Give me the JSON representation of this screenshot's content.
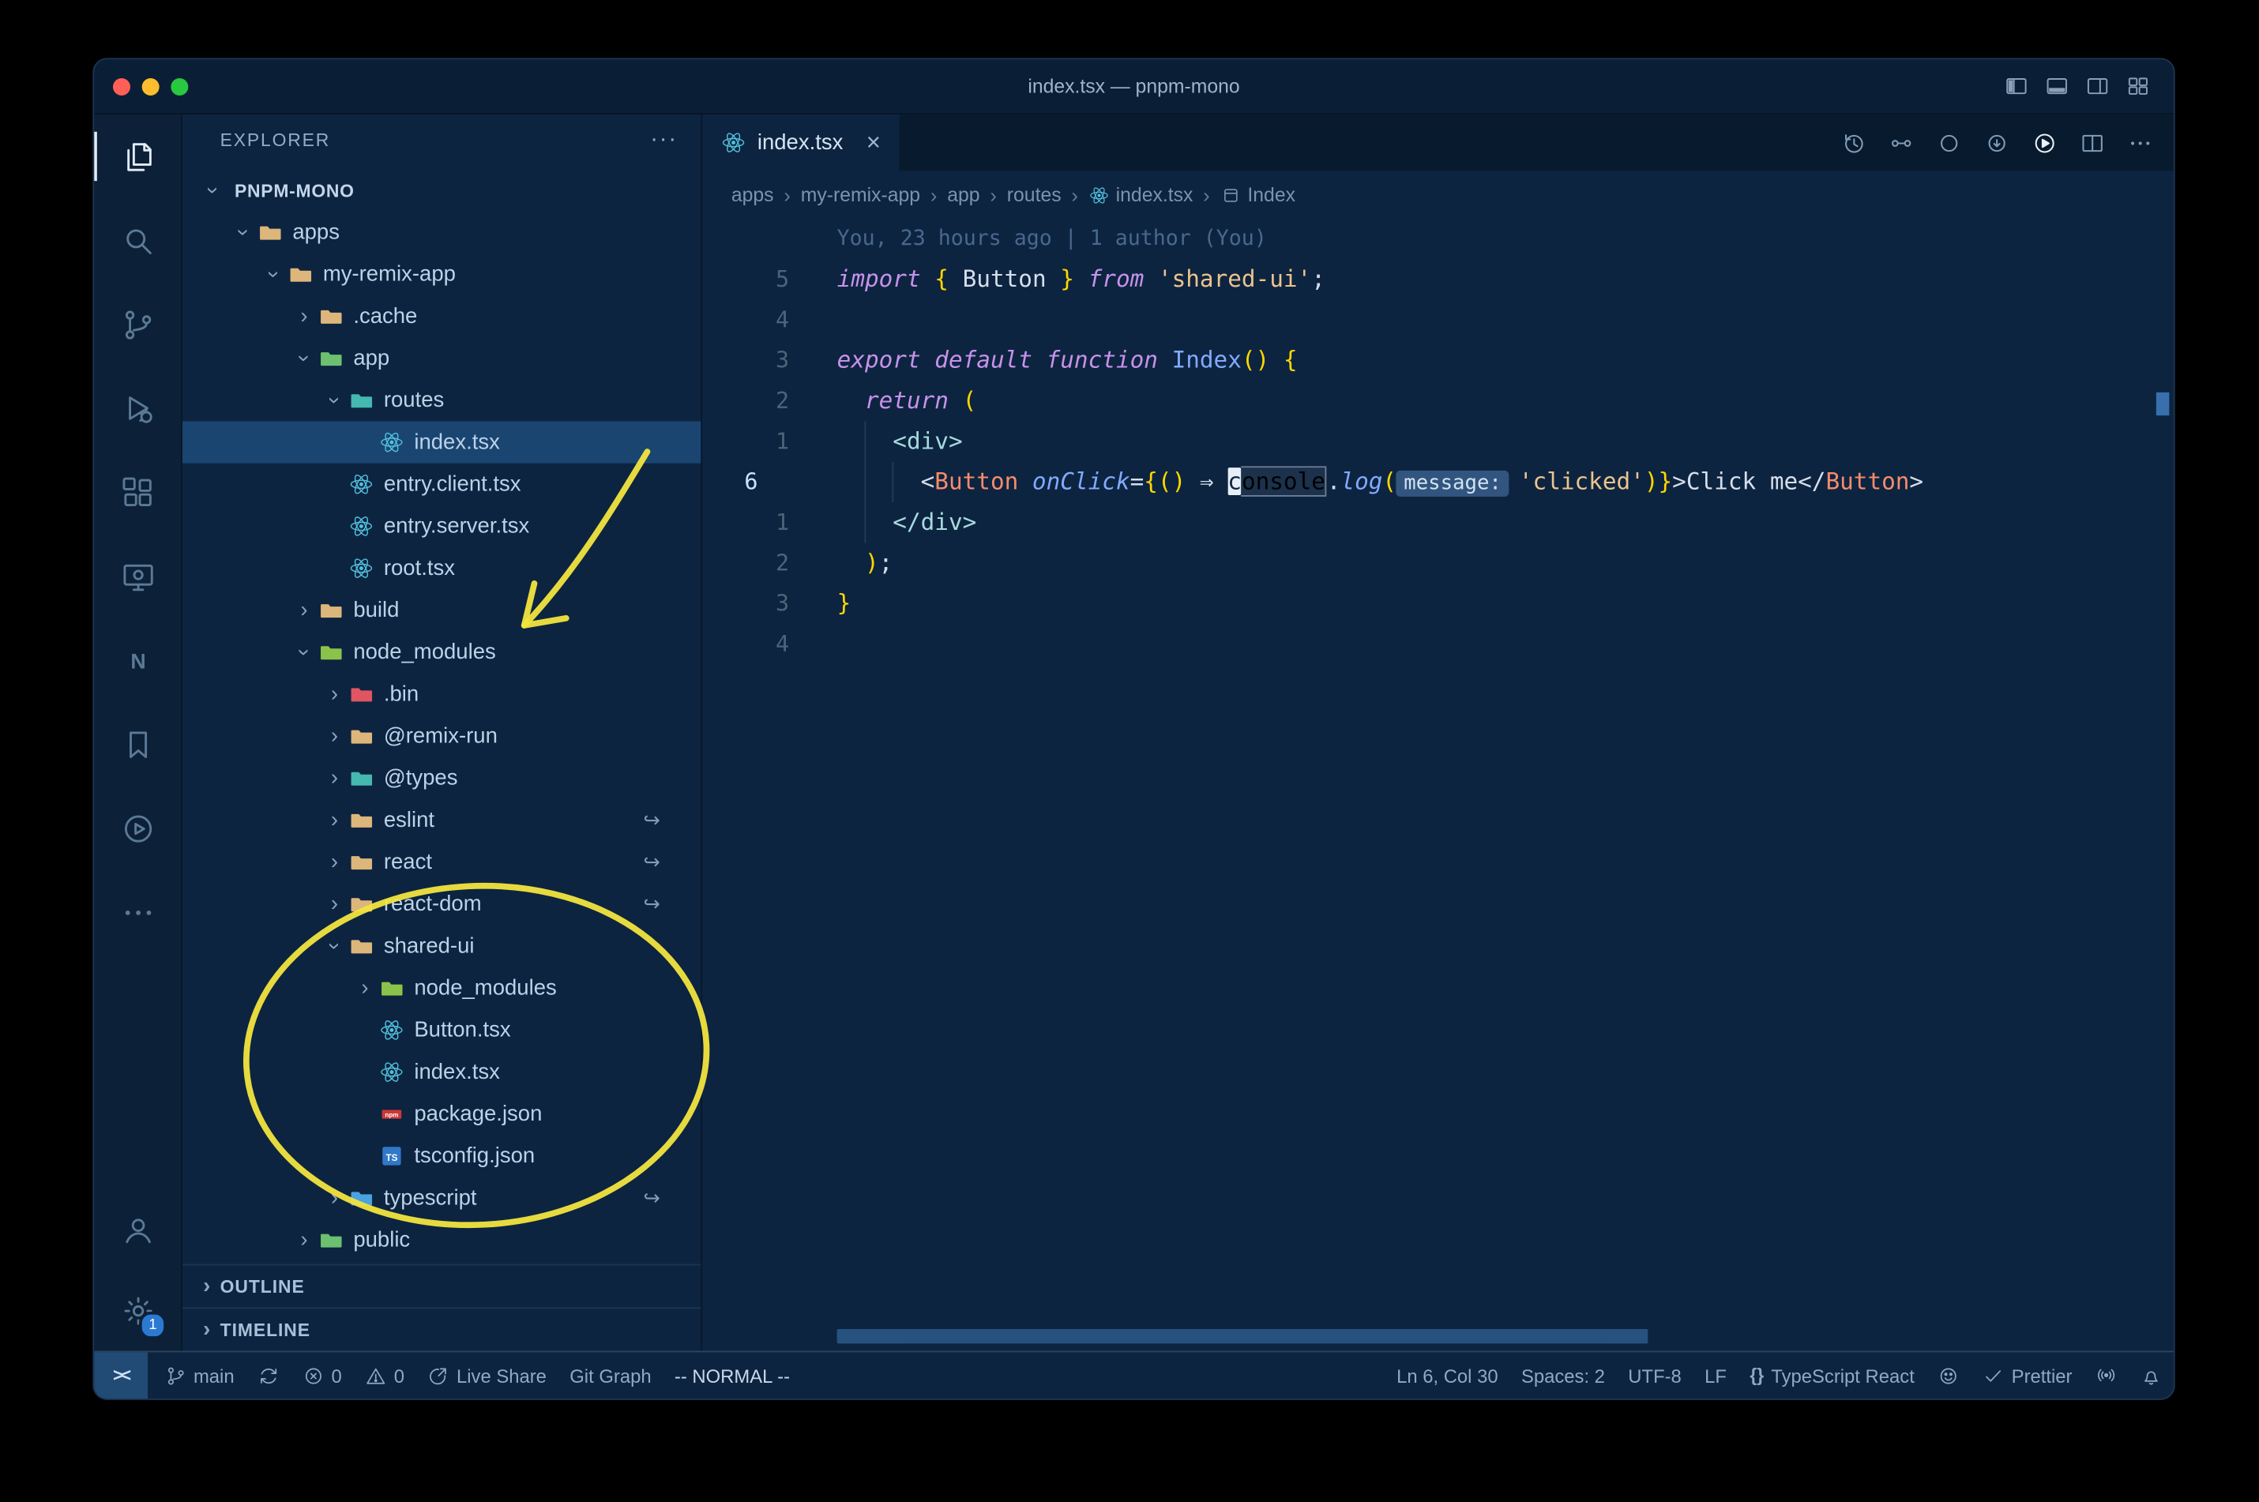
{
  "window": {
    "title": "index.tsx — pnpm-mono"
  },
  "titlebar_icons": [
    "layout-sidebar-icon",
    "layout-panel-icon",
    "layout-split-icon",
    "layout-grid-icon"
  ],
  "activity_bar": {
    "top": [
      {
        "name": "explorer",
        "icon": "files-icon",
        "active": true
      },
      {
        "name": "search",
        "icon": "search-icon"
      },
      {
        "name": "source-control",
        "icon": "scm-icon"
      },
      {
        "name": "run-debug",
        "icon": "debug-icon"
      },
      {
        "name": "extensions",
        "icon": "extensions-icon"
      },
      {
        "name": "live-preview",
        "icon": "monitor-icon"
      },
      {
        "name": "nx-console",
        "icon": "nx-icon"
      },
      {
        "name": "bookmarks",
        "icon": "bookmark-icon"
      },
      {
        "name": "code-runner",
        "icon": "circle-play-icon"
      },
      {
        "name": "more-views",
        "icon": "more-icon"
      }
    ],
    "bottom": [
      {
        "name": "accounts",
        "icon": "account-icon"
      },
      {
        "name": "settings",
        "icon": "gear-icon",
        "badge": "1"
      }
    ]
  },
  "sidebar": {
    "header": "EXPLORER",
    "header_more": "···",
    "chevron_char": "›",
    "symlink_char": "↪",
    "sections": [
      "OUTLINE",
      "TIMELINE"
    ],
    "tree": [
      {
        "label": "PNPM-MONO",
        "depth": 0,
        "chev": "down",
        "icon": null,
        "root": true
      },
      {
        "label": "apps",
        "depth": 1,
        "chev": "down",
        "icon": "folder-tan"
      },
      {
        "label": "my-remix-app",
        "depth": 2,
        "chev": "down",
        "icon": "folder-tan"
      },
      {
        "label": ".cache",
        "depth": 3,
        "chev": "right",
        "icon": "folder-tan"
      },
      {
        "label": "app",
        "depth": 3,
        "chev": "down",
        "icon": "folder-green"
      },
      {
        "label": "routes",
        "depth": 4,
        "chev": "down",
        "icon": "folder-teal"
      },
      {
        "label": "index.tsx",
        "depth": 5,
        "chev": null,
        "icon": "react",
        "selected": true
      },
      {
        "label": "entry.client.tsx",
        "depth": 4,
        "chev": null,
        "icon": "react"
      },
      {
        "label": "entry.server.tsx",
        "depth": 4,
        "chev": null,
        "icon": "react"
      },
      {
        "label": "root.tsx",
        "depth": 4,
        "chev": null,
        "icon": "react"
      },
      {
        "label": "build",
        "depth": 3,
        "chev": "right",
        "icon": "folder-tan"
      },
      {
        "label": "node_modules",
        "depth": 3,
        "chev": "down",
        "icon": "folder-green2"
      },
      {
        "label": ".bin",
        "depth": 4,
        "chev": "right",
        "icon": "folder-red"
      },
      {
        "label": "@remix-run",
        "depth": 4,
        "chev": "right",
        "icon": "folder-tan"
      },
      {
        "label": "@types",
        "depth": 4,
        "chev": "right",
        "icon": "folder-teal"
      },
      {
        "label": "eslint",
        "depth": 4,
        "chev": "right",
        "icon": "folder-tan",
        "symlink": true
      },
      {
        "label": "react",
        "depth": 4,
        "chev": "right",
        "icon": "folder-tan",
        "symlink": true
      },
      {
        "label": "react-dom",
        "depth": 4,
        "chev": "right",
        "icon": "folder-tan",
        "symlink": true
      },
      {
        "label": "shared-ui",
        "depth": 4,
        "chev": "down",
        "icon": "folder-tan"
      },
      {
        "label": "node_modules",
        "depth": 5,
        "chev": "right",
        "icon": "folder-green2"
      },
      {
        "label": "Button.tsx",
        "depth": 5,
        "chev": null,
        "icon": "react"
      },
      {
        "label": "index.tsx",
        "depth": 5,
        "chev": null,
        "icon": "react"
      },
      {
        "label": "package.json",
        "depth": 5,
        "chev": null,
        "icon": "npm"
      },
      {
        "label": "tsconfig.json",
        "depth": 5,
        "chev": null,
        "icon": "ts"
      },
      {
        "label": "typescript",
        "depth": 4,
        "chev": "right",
        "icon": "folder-blue",
        "symlink": true
      },
      {
        "label": "public",
        "depth": 3,
        "chev": "right",
        "icon": "folder-green"
      }
    ]
  },
  "editor": {
    "tab": {
      "label": "index.tsx",
      "close": "×"
    },
    "actions": [
      "history-icon",
      "compare-icon",
      "circle-icon",
      "circle-arrow-icon",
      "run-circle-icon",
      "split-editor-icon",
      "more-actions-icon"
    ],
    "separator": "›",
    "breadcrumbs": [
      {
        "label": "apps"
      },
      {
        "label": "my-remix-app"
      },
      {
        "label": "app"
      },
      {
        "label": "routes"
      },
      {
        "label": "index.tsx",
        "icon": "react-icon"
      },
      {
        "label": "Index",
        "icon": "symbol-icon"
      }
    ],
    "blame": "You, 23 hours ago | 1 author (You)",
    "lines": [
      {
        "n": "5",
        "segs": [
          [
            "kw",
            "import"
          ],
          [
            "pc",
            " "
          ],
          [
            "br",
            "{"
          ],
          [
            "pc",
            " "
          ],
          [
            "pc",
            "Button"
          ],
          [
            "pc",
            " "
          ],
          [
            "br",
            "}"
          ],
          [
            "pc",
            " "
          ],
          [
            "kw",
            "from"
          ],
          [
            "pc",
            " "
          ],
          [
            "str",
            "'shared-ui'"
          ],
          [
            "pc",
            ";"
          ]
        ]
      },
      {
        "n": "4",
        "segs": []
      },
      {
        "n": "3",
        "segs": [
          [
            "kw",
            "export"
          ],
          [
            "pc",
            " "
          ],
          [
            "kw",
            "default"
          ],
          [
            "pc",
            " "
          ],
          [
            "kw",
            "function"
          ],
          [
            "pc",
            " "
          ],
          [
            "fn",
            "Index"
          ],
          [
            "br",
            "()"
          ],
          [
            "pc",
            " "
          ],
          [
            "br",
            "{"
          ]
        ]
      },
      {
        "n": "2",
        "segs": [
          [
            "pc",
            "  "
          ],
          [
            "kw",
            "return"
          ],
          [
            "pc",
            " "
          ],
          [
            "br",
            "("
          ]
        ]
      },
      {
        "n": "1",
        "segs": [
          [
            "pc",
            "    "
          ],
          [
            "tag",
            "<div>"
          ]
        ]
      },
      {
        "n": "6",
        "current": true,
        "segs": [
          [
            "pc",
            "      "
          ],
          [
            "pc",
            "<"
          ],
          [
            "cmp",
            "Button"
          ],
          [
            "pc",
            " "
          ],
          [
            "attr",
            "onClick"
          ],
          [
            "pc",
            "="
          ],
          [
            "br",
            "{"
          ],
          [
            "br",
            "()"
          ],
          [
            "pc",
            " "
          ],
          [
            "arrow",
            "⇒"
          ],
          [
            "pc",
            " "
          ],
          [
            "cur",
            "c"
          ],
          [
            "hlw",
            "onsole"
          ],
          [
            "pc",
            "."
          ],
          [
            "fni",
            "log"
          ],
          [
            "br",
            "("
          ],
          [
            "hint",
            "message:"
          ],
          [
            "str",
            "'clicked'"
          ],
          [
            "br",
            ")"
          ],
          [
            "br",
            "}"
          ],
          [
            "pc",
            ">"
          ],
          [
            "txt",
            "Click me"
          ],
          [
            "pc",
            "</"
          ],
          [
            "cmp",
            "Button"
          ],
          [
            "pc",
            ">"
          ]
        ]
      },
      {
        "n": "1",
        "segs": [
          [
            "pc",
            "    "
          ],
          [
            "tag",
            "</div>"
          ]
        ]
      },
      {
        "n": "2",
        "segs": [
          [
            "pc",
            "  "
          ],
          [
            "br",
            ")"
          ],
          [
            "pc",
            ";"
          ]
        ]
      },
      {
        "n": "3",
        "segs": [
          [
            "br",
            "}"
          ]
        ]
      },
      {
        "n": "4",
        "segs": []
      }
    ]
  },
  "status_bar": {
    "left": [
      {
        "icon": "remote-icon",
        "kind": "remote"
      },
      {
        "icon": "branch-icon",
        "label": "main"
      },
      {
        "icon": "sync-icon"
      },
      {
        "icon": "error-icon",
        "label": "0"
      },
      {
        "icon": "warning-icon",
        "label": "0"
      },
      {
        "icon": "liveshare-icon",
        "label": "Live Share"
      },
      {
        "label": "Git Graph"
      },
      {
        "label": "-- NORMAL --",
        "em": true
      }
    ],
    "right": [
      {
        "label": "Ln 6, Col 30"
      },
      {
        "label": "Spaces: 2"
      },
      {
        "label": "UTF-8"
      },
      {
        "label": "LF"
      },
      {
        "icon": "braces-icon",
        "label": "TypeScript React"
      },
      {
        "icon": "smiley-icon"
      },
      {
        "icon": "check-icon",
        "label": "Prettier"
      },
      {
        "icon": "cast-icon"
      },
      {
        "icon": "bell-icon"
      }
    ]
  },
  "annotations": {
    "color": "#f2e53e"
  },
  "colors": {
    "accent": "#53c1de",
    "selection": "#1a4571",
    "annotation_yellow": "#f2e53e",
    "bracket_gold": "#ffd700"
  }
}
